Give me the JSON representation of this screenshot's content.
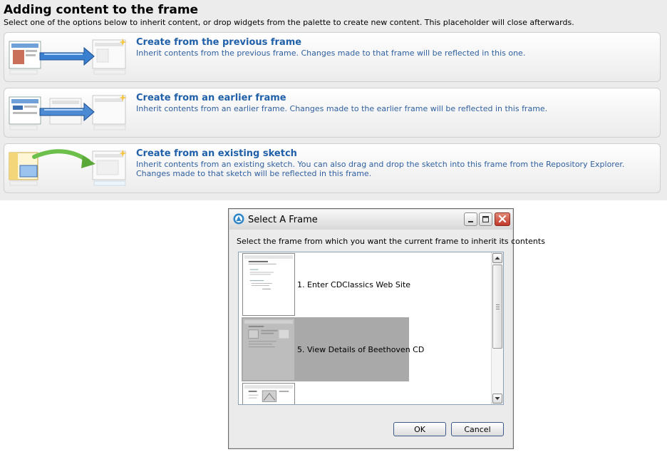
{
  "header": {
    "title": "Adding content to the frame",
    "subtitle": "Select one of the options below to inherit content, or drop widgets from the palette to create new content. This placeholder will close afterwards."
  },
  "options": [
    {
      "title": "Create from the previous frame",
      "description": "Inherit contents from the previous frame. Changes made to that frame will be reflected in this one."
    },
    {
      "title": "Create from an earlier frame",
      "description": "Inherit contents from an earlier frame. Changes made to the earlier frame will be reflected in this frame."
    },
    {
      "title": "Create from an existing sketch",
      "description": "Inherit contents from an existing sketch. You can also drag and drop the sketch into this frame from the Repository Explorer. Changes made to that sketch will be reflected in this frame."
    }
  ],
  "dialog": {
    "title": "Select A Frame",
    "instruction": "Select the frame from which you want the current frame to inherit its contents",
    "frames": [
      {
        "label": "1. Enter CDClassics Web Site",
        "selected": false
      },
      {
        "label": "5. View Details of Beethoven CD",
        "selected": true
      },
      {
        "label": "",
        "selected": false
      }
    ],
    "ok_label": "OK",
    "cancel_label": "Cancel"
  },
  "colors": {
    "option_title": "#2060a8",
    "option_text": "#3060a0",
    "selected_row": "#a9a9a9",
    "close_button": "#c0392b"
  },
  "icons": {
    "option_1": "previous-frame-illustration",
    "option_2": "earlier-frame-illustration",
    "option_3": "existing-sketch-illustration",
    "dialog": "app-icon",
    "window_controls": [
      "minimize-icon",
      "maximize-icon",
      "close-icon"
    ],
    "scroll": [
      "scroll-up-icon",
      "scroll-down-icon"
    ]
  }
}
